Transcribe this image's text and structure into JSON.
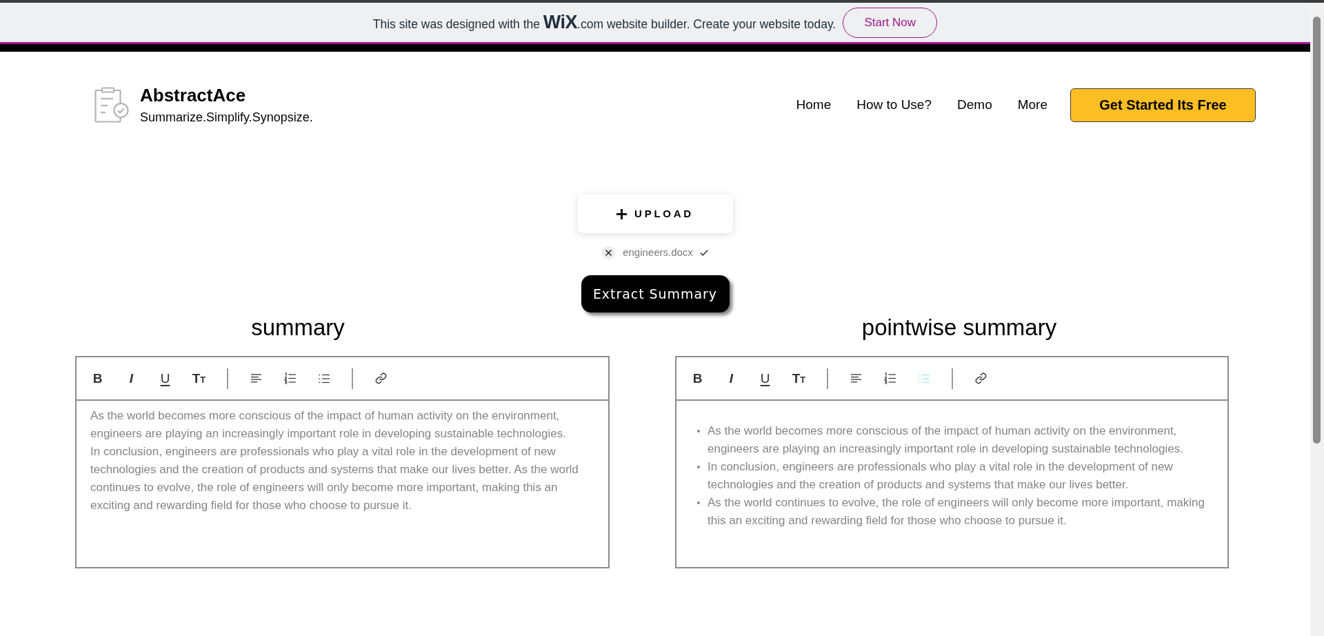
{
  "banner": {
    "message": "This site was designed with the **WiX**.com website builder. Create your website today.",
    "button": "Start Now"
  },
  "header": {
    "brand": {
      "name": "AbstractAce",
      "tagline": "Summarize.Simplify.Synopsize."
    },
    "nav": [
      {
        "label": "Home"
      },
      {
        "label": "How to Use?"
      },
      {
        "label": "Demo"
      },
      {
        "label": "More"
      }
    ],
    "cta": "Get Started Its Free"
  },
  "upload": {
    "button": "UPLOAD",
    "file": {
      "name": "engineers.docx",
      "uploaded": true
    }
  },
  "extract_button": "Extract Summary",
  "editors": [
    {
      "title": "summary",
      "kind": "paragraphs",
      "toolbar": [
        {
          "kind": "bold",
          "label": "B",
          "active": false
        },
        {
          "kind": "italic",
          "label": "I",
          "active": false
        },
        {
          "kind": "underline",
          "label": "U",
          "active": false
        },
        {
          "kind": "text_size",
          "label": "T$_{T}$",
          "active": false
        },
        {
          "kind": "separator"
        },
        {
          "kind": "align_left",
          "active": false
        },
        {
          "kind": "numbered_list",
          "active": false
        },
        {
          "kind": "bullet_list",
          "active": false
        },
        {
          "kind": "separator"
        },
        {
          "kind": "link",
          "active": false
        }
      ],
      "content": [
        "As the world becomes more conscious of the impact of human activity on the environment, engineers are playing an increasingly important role in developing sustainable technologies.",
        "In conclusion, engineers are professionals who play a vital role in the development of new technologies and the creation of products and systems that make our lives better. As the world continues to evolve, the role of engineers will only become more important, making this an exciting and rewarding field for those who choose to pursue it."
      ]
    },
    {
      "title": "pointwise summary",
      "kind": "bullets",
      "toolbar": [
        {
          "kind": "bold",
          "label": "B",
          "active": false
        },
        {
          "kind": "italic",
          "label": "I",
          "active": false
        },
        {
          "kind": "underline",
          "label": "U",
          "active": false
        },
        {
          "kind": "text_size",
          "label": "T$_{T}$",
          "active": false
        },
        {
          "kind": "separator"
        },
        {
          "kind": "align_left",
          "active": false
        },
        {
          "kind": "numbered_list",
          "active": false
        },
        {
          "kind": "bullet_list",
          "active": true
        },
        {
          "kind": "separator"
        },
        {
          "kind": "link",
          "active": false
        }
      ],
      "content": [
        "As the world becomes more conscious of the impact of human activity on the environment, engineers are playing an increasingly important role in developing sustainable technologies.",
        "In conclusion, engineers are professionals who play a vital role in the development of new technologies and the creation of products and systems that make our lives better.",
        "As the world continues to evolve, the role of engineers will only become more important, making this an exciting and rewarding field for those who choose to pursue it."
      ]
    }
  ]
}
